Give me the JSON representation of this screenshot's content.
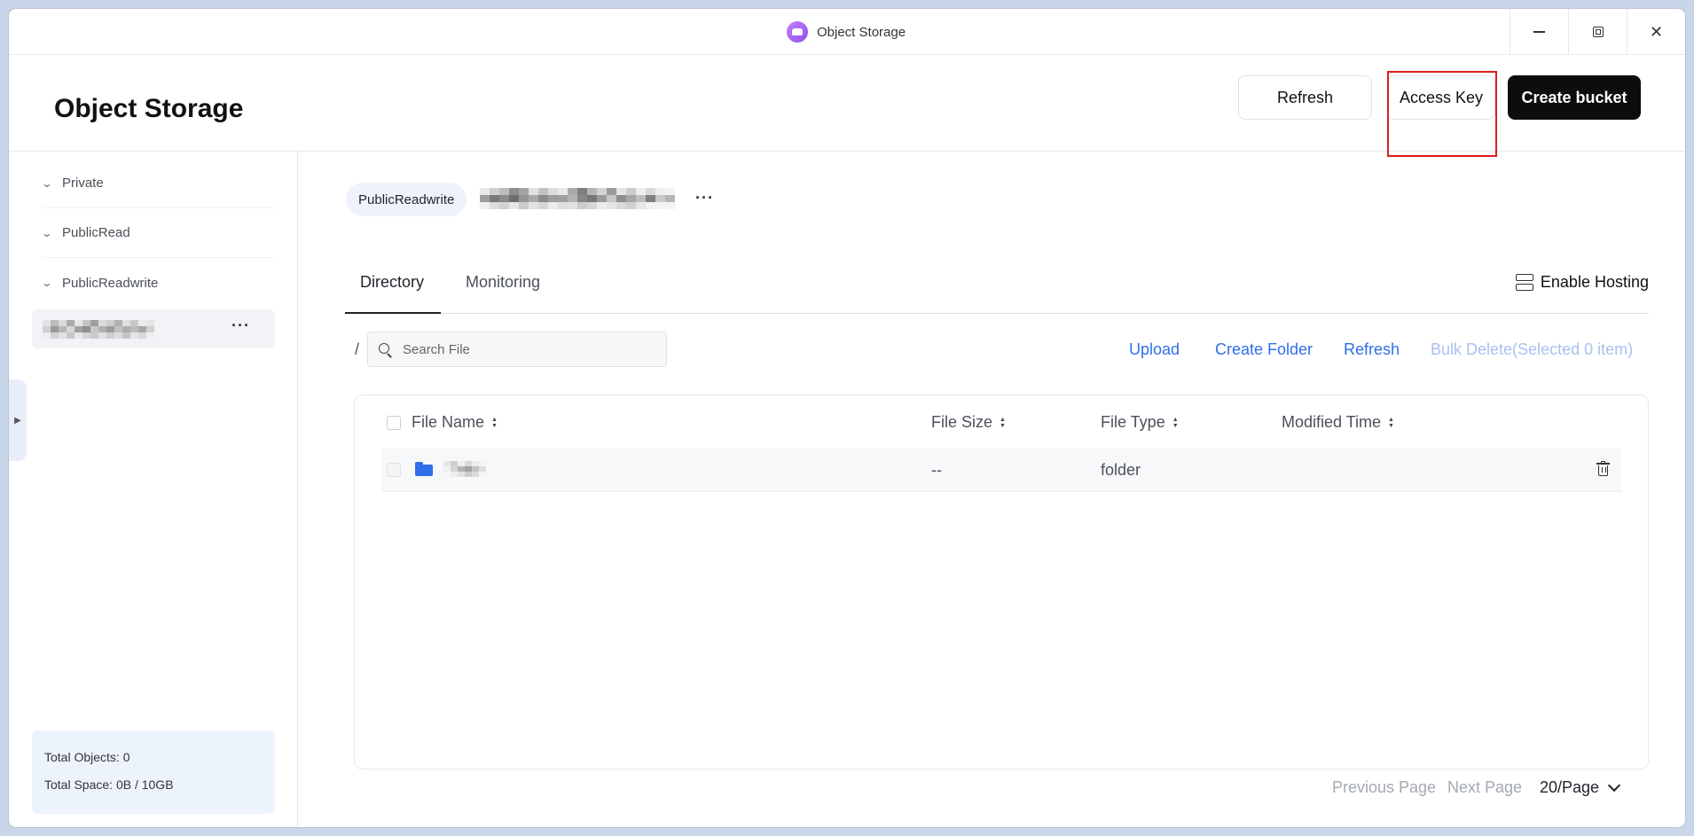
{
  "window": {
    "title": "Object Storage",
    "icons": {
      "app": "app-logo-icon",
      "minimize": "minimize-icon",
      "maximize": "maximize-icon",
      "close": "close-icon"
    }
  },
  "header": {
    "title": "Object Storage",
    "refresh_label": "Refresh",
    "access_key_label": "Access Key",
    "create_bucket_label": "Create bucket"
  },
  "sidebar": {
    "groups": [
      {
        "label": "Private"
      },
      {
        "label": "PublicRead"
      },
      {
        "label": "PublicReadwrite"
      }
    ],
    "stats": {
      "total_objects": "Total Objects: 0",
      "total_space": "Total Space: 0B / 10GB"
    }
  },
  "main": {
    "bucket_type": "PublicReadwrite",
    "tabs": [
      {
        "label": "Directory"
      },
      {
        "label": "Monitoring"
      }
    ],
    "enable_hosting_label": "Enable Hosting",
    "path": "/",
    "search": {
      "placeholder": "Search File",
      "value": ""
    },
    "actions": {
      "upload": "Upload",
      "create_folder": "Create Folder",
      "refresh": "Refresh",
      "bulk_delete": "Bulk Delete(Selected 0 item)"
    },
    "table": {
      "columns": [
        "File Name",
        "File Size",
        "File Type",
        "Modified Time"
      ],
      "rows": [
        {
          "size": "--",
          "type": "folder",
          "modified": ""
        }
      ]
    },
    "pagination": {
      "prev": "Previous Page",
      "next": "Next Page",
      "page_size": "20/Page"
    }
  },
  "colors": {
    "accent": "#2f6fe8",
    "primary_button": "#0d0d0d",
    "highlight": "#e01e1e"
  }
}
